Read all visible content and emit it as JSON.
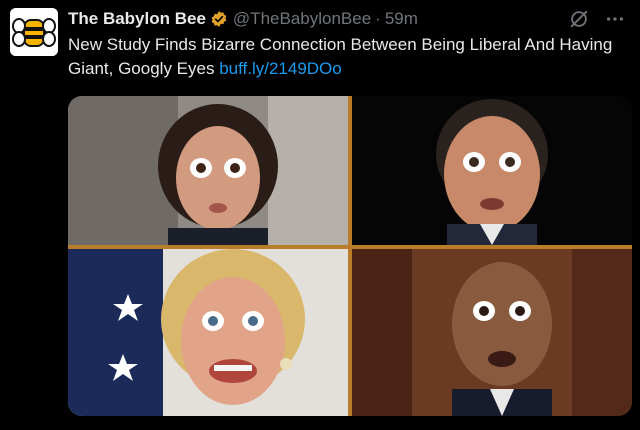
{
  "tweet": {
    "author_name": "The Babylon Bee",
    "handle": "@TheBabylonBee",
    "separator": "·",
    "timestamp": "59m",
    "text": "New Study Finds Bizarre Connection Between Being Liberal And Having Giant, Googly Eyes ",
    "link_text": "buff.ly/2149DOo"
  },
  "icons": {
    "avatar": "babylon-bee-logo-icon",
    "verified": "verified-badge-icon",
    "grok": "grok-icon",
    "more": "more-options-icon"
  },
  "colors": {
    "background": "#000000",
    "text": "#e7e9ea",
    "muted": "#71767b",
    "link": "#1d9bf0",
    "verified_badge": "#e2a22a",
    "logo_yellow": "#f5b400"
  },
  "media": {
    "photos": [
      {
        "subject": "woman-wide-eyes"
      },
      {
        "subject": "man-wide-eyes"
      },
      {
        "subject": "smiling-woman-wide-eyes"
      },
      {
        "subject": "bald-man-wide-eyes"
      }
    ]
  }
}
